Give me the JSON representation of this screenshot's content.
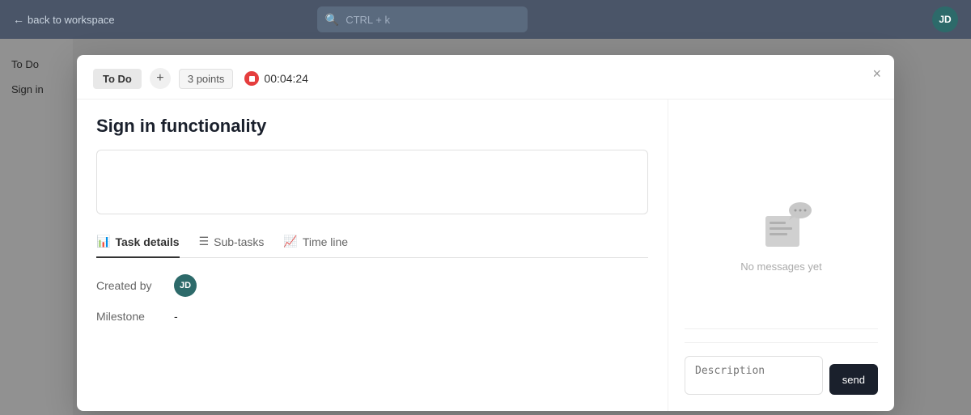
{
  "topbar": {
    "back_label": "back to workspace",
    "search_placeholder": "CTRL + k",
    "avatar_initials": "JD"
  },
  "sidebar": {
    "section_label": "To Do",
    "item_label": "Sign in"
  },
  "modal": {
    "status_label": "To Do",
    "add_icon": "+",
    "points_label": "3 points",
    "timer_value": "00:04:24",
    "close_icon": "×",
    "task_title": "Sign in functionality",
    "description_placeholder": "",
    "tabs": [
      {
        "id": "task-details",
        "label": "Task details",
        "icon": "📊",
        "active": true
      },
      {
        "id": "sub-tasks",
        "label": "Sub-tasks",
        "icon": "☰",
        "active": false
      },
      {
        "id": "time-line",
        "label": "Time line",
        "icon": "📈",
        "active": false
      }
    ],
    "created_by_label": "Created by",
    "creator_initials": "JD",
    "milestone_label": "Milestone",
    "milestone_value": "-",
    "no_messages_label": "No messages yet",
    "message_placeholder": "Description",
    "send_label": "send"
  }
}
